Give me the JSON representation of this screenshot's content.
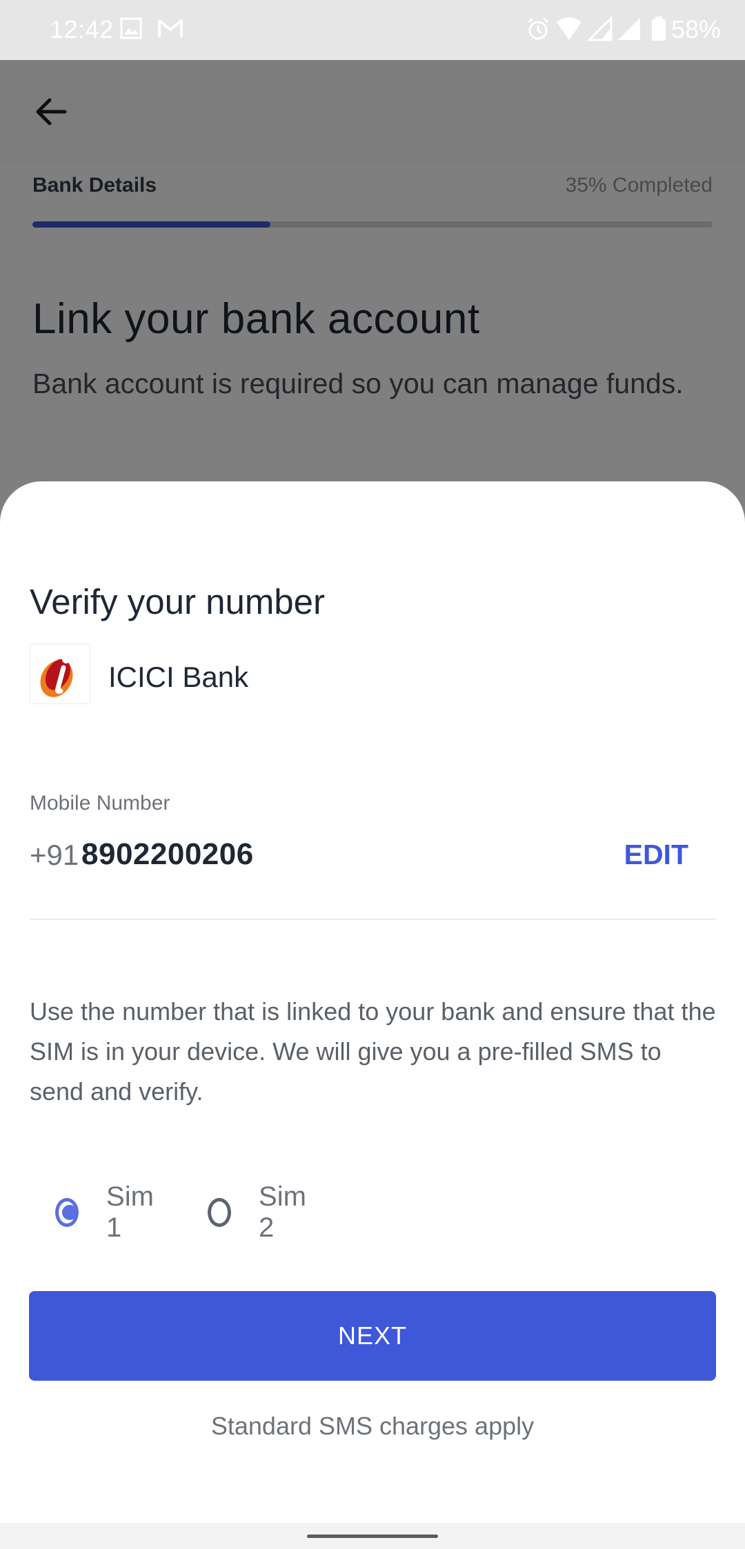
{
  "status_bar": {
    "time": "12:42",
    "battery": "58%",
    "icons": [
      "image-icon",
      "gmail-icon",
      "alarm-icon",
      "wifi-icon",
      "signal-1-icon",
      "signal-2-icon",
      "battery-icon"
    ]
  },
  "background_page": {
    "step_label": "Bank Details",
    "progress_text": "35% Completed",
    "progress_fraction": 0.35,
    "title": "Link your bank account",
    "subtitle": "Bank account is required so you can manage funds."
  },
  "sheet": {
    "title": "Verify your number",
    "bank_name": "ICICI Bank",
    "mobile_label": "Mobile Number",
    "country_code": "+91",
    "mobile_number": "8902200206",
    "edit_label": "EDIT",
    "info": "Use the number that is linked to your bank and ensure that the SIM is in your device. We will give you a pre-filled SMS to send and verify.",
    "sim_options": [
      {
        "label": "Sim 1",
        "selected": true
      },
      {
        "label": "Sim 2",
        "selected": false
      }
    ],
    "next_label": "NEXT",
    "footnote": "Standard SMS charges apply"
  },
  "colors": {
    "accent": "#3f57d9",
    "radio_selected": "#5a6fe0",
    "text_dark": "#1e2734",
    "text_muted": "#6d7279"
  }
}
